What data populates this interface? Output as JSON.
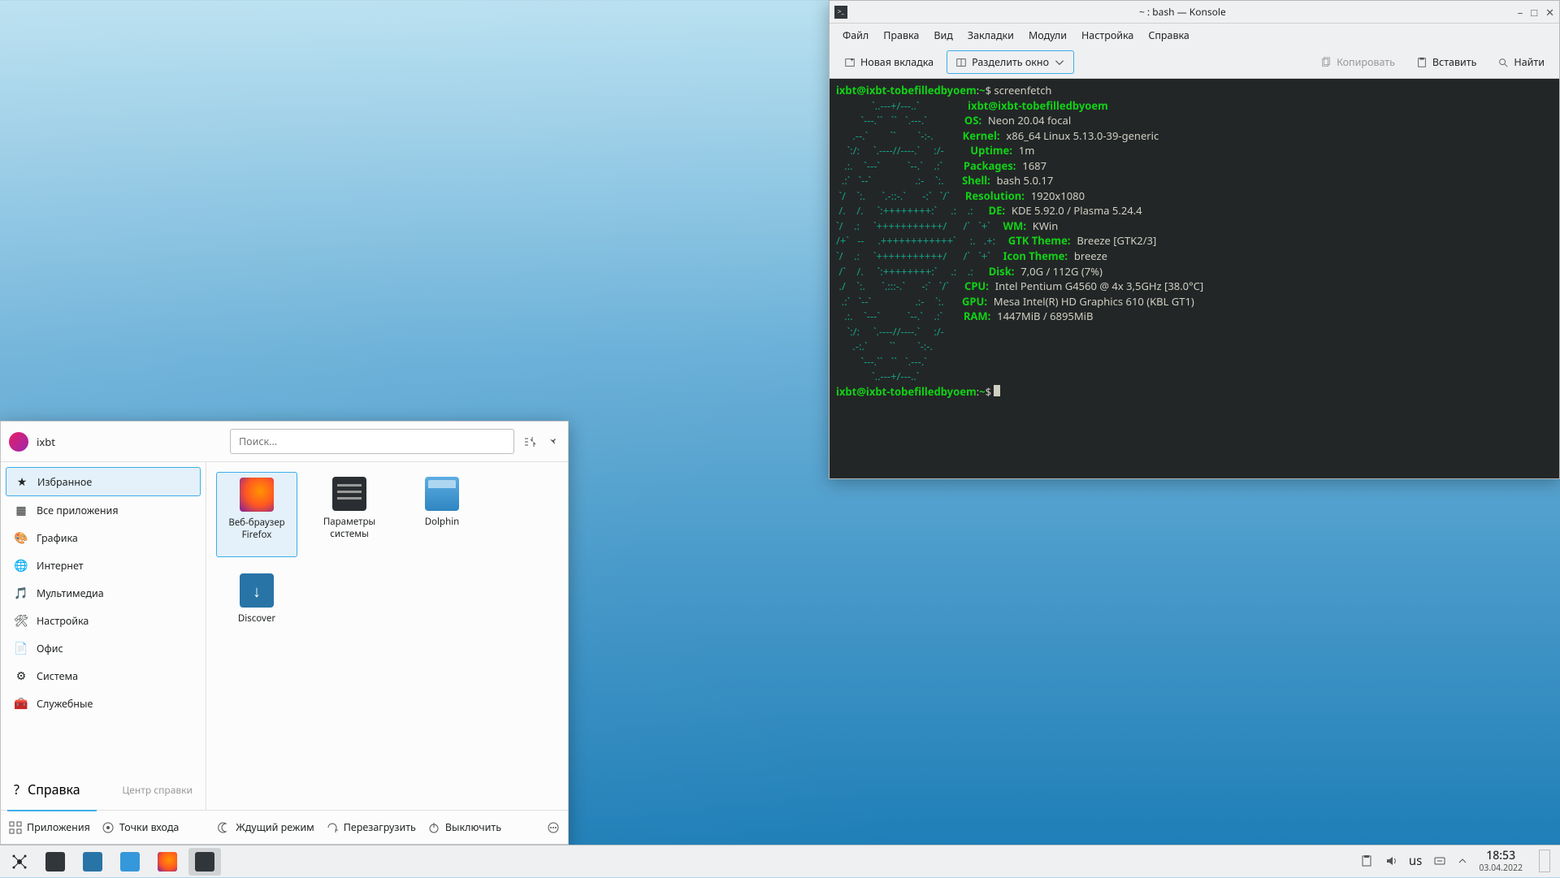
{
  "konsole": {
    "title": "~ : bash — Konsole",
    "menubar": [
      "Файл",
      "Правка",
      "Вид",
      "Закладки",
      "Модули",
      "Настройка",
      "Справка"
    ],
    "toolbar": {
      "new_tab": "Новая вкладка",
      "split": "Разделить окно",
      "copy": "Копировать",
      "paste": "Вставить",
      "find": "Найти"
    },
    "prompt": {
      "user_host": "ixbt@ixbt-tobefilledbyoem",
      "path": "~",
      "symbol": "$",
      "command": "screenfetch"
    },
    "screenfetch": {
      "header": "ixbt@ixbt-tobefilledbyoem",
      "lines": [
        {
          "k": "OS:",
          "v": "Neon 20.04 focal"
        },
        {
          "k": "Kernel:",
          "v": "x86_64 Linux 5.13.0-39-generic"
        },
        {
          "k": "Uptime:",
          "v": "1m"
        },
        {
          "k": "Packages:",
          "v": "1687"
        },
        {
          "k": "Shell:",
          "v": "bash 5.0.17"
        },
        {
          "k": "Resolution:",
          "v": "1920x1080"
        },
        {
          "k": "DE:",
          "v": "KDE 5.92.0 / Plasma 5.24.4"
        },
        {
          "k": "WM:",
          "v": "KWin"
        },
        {
          "k": "GTK Theme:",
          "v": "Breeze [GTK2/3]"
        },
        {
          "k": "Icon Theme:",
          "v": "breeze"
        },
        {
          "k": "Disk:",
          "v": "7,0G / 112G (7%)"
        },
        {
          "k": "CPU:",
          "v": "Intel Pentium G4560 @ 4x 3,5GHz [38.0°C]"
        },
        {
          "k": "GPU:",
          "v": "Mesa Intel(R) HD Graphics 610 (KBL GT1)"
        },
        {
          "k": "RAM:",
          "v": "1447MiB / 6895MiB"
        }
      ],
      "ascii": [
        "             `..---+/---..`",
        "         `---.``   ``   `.---.`",
        "      .--.`        ``        `-:-.",
        "    `:/:     `.----//----.`     :/-",
        "   .:.    `---`          `--.`    .:`",
        "  .:`   `--`                .:-    `:.",
        " `/    `:.      `.-::-.`      -:`   `/`",
        " /.    /.     `:++++++++:`     .:    .:",
        "`/    .:     `+++++++++++/      /`   `+`",
        "/+`   --     .++++++++++++`     :.   .+:",
        "`/    .:     `+++++++++++/      /`   `+`",
        " /`    /.     `:++++++++:`     .:    .:",
        " ./    `:.      `.:::-.`      -:`   `/`",
        "  .:`   `--`                .:-    `:.",
        "   .:.    `---`          `--.`    .:`",
        "    `:/:     `.----//----.`     :/-",
        "      .-:.`        ``        `-:-.",
        "         `---.``   ``   `.---.`",
        "             `..---+/---..`"
      ]
    }
  },
  "kickoff": {
    "user": "ixbt",
    "search_placeholder": "Поиск...",
    "categories": [
      {
        "label": "Избранное",
        "active": true
      },
      {
        "label": "Все приложения"
      },
      {
        "label": "Графика"
      },
      {
        "label": "Интернет"
      },
      {
        "label": "Мультимедиа"
      },
      {
        "label": "Настройка"
      },
      {
        "label": "Офис"
      },
      {
        "label": "Система"
      },
      {
        "label": "Служебные"
      }
    ],
    "help": {
      "label": "Справка",
      "hint": "Центр справки"
    },
    "favorites": [
      {
        "label": "Веб-браузер Firefox",
        "icon": "firefox",
        "active": true
      },
      {
        "label": "Параметры системы",
        "icon": "settings"
      },
      {
        "label": "Dolphin",
        "icon": "dolphin"
      },
      {
        "label": "Discover",
        "icon": "discover"
      }
    ],
    "footer": {
      "applications": "Приложения",
      "places": "Точки входа",
      "sleep": "Ждущий режим",
      "restart": "Перезагрузить",
      "shutdown": "Выключить"
    }
  },
  "taskbar": {
    "layout": "us",
    "time": "18:53",
    "date": "03.04.2022"
  }
}
